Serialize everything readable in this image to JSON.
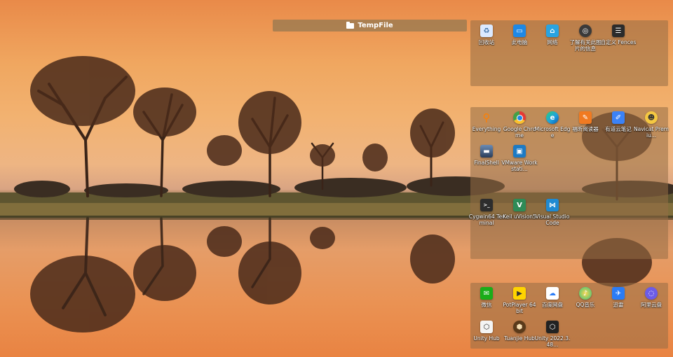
{
  "tempfile_fence": {
    "title": "TempFile",
    "icon": "folder-icon"
  },
  "fence_system": {
    "items": [
      {
        "label": "回收站",
        "icon": "recycle-bin-icon",
        "color": "#cfe3ff"
      },
      {
        "label": "此电脑",
        "icon": "this-pc-icon",
        "color": "#1e88e5"
      },
      {
        "label": "网络",
        "icon": "network-icon",
        "color": "#29a3e0"
      },
      {
        "label": "了解有关此图片的信息",
        "icon": "camera-info-icon",
        "color": "#3a3a3a"
      },
      {
        "label": "自定义 Fences",
        "icon": "fences-icon",
        "color": "#2b2b2b"
      }
    ]
  },
  "fence_apps": {
    "items": [
      {
        "label": "Everything",
        "icon": "everything-search-icon",
        "color": "#ff7f00"
      },
      {
        "label": "Google Chrome",
        "icon": "chrome-icon",
        "color": "#e53935"
      },
      {
        "label": "Microsoft Edge",
        "icon": "edge-icon",
        "color": "#1ea1e0"
      },
      {
        "label": "福昕阅读器",
        "icon": "foxit-icon",
        "color": "#f07a21"
      },
      {
        "label": "有道云笔记",
        "icon": "youdao-note-icon",
        "color": "#3b82f6"
      },
      {
        "label": "Navicat Premiu...",
        "icon": "navicat-icon",
        "color": "#f5c842"
      },
      {
        "label": "FinalShell",
        "icon": "finalshell-icon",
        "color": "#3d5a80"
      },
      {
        "label": "VMware Workstati...",
        "icon": "vmware-icon",
        "color": "#1d7ac4"
      },
      {
        "label": "Cygwin64 Terminal",
        "icon": "cygwin-terminal-icon",
        "color": "#2d2d2d"
      },
      {
        "label": "Keil uVision5",
        "icon": "keil-icon",
        "color": "#2e8b57"
      },
      {
        "label": "Visual Studio Code",
        "icon": "vscode-icon",
        "color": "#1f8ad2"
      }
    ]
  },
  "fence_social": {
    "items": [
      {
        "label": "微信",
        "icon": "wechat-icon",
        "color": "#1aad19"
      },
      {
        "label": "PotPlayer 64 bit",
        "icon": "potplayer-icon",
        "color": "#ffd400"
      },
      {
        "label": "百度网盘",
        "icon": "baidu-netdisk-icon",
        "color": "#ffffff"
      },
      {
        "label": "QQ音乐",
        "icon": "qq-music-icon",
        "color": "#31c27c"
      },
      {
        "label": "迅雷",
        "icon": "thunder-icon",
        "color": "#2b7cf6"
      },
      {
        "label": "阿里云盘",
        "icon": "aliyun-drive-icon",
        "color": "#6c5ce7"
      },
      {
        "label": "Unity Hub",
        "icon": "unity-hub-icon",
        "color": "#222222"
      },
      {
        "label": "Tuanjie Hub",
        "icon": "tuanjie-hub-icon",
        "color": "#5a3a1a"
      },
      {
        "label": "Unity 2022.3.48...",
        "icon": "unity-editor-icon",
        "color": "#222222"
      }
    ]
  }
}
